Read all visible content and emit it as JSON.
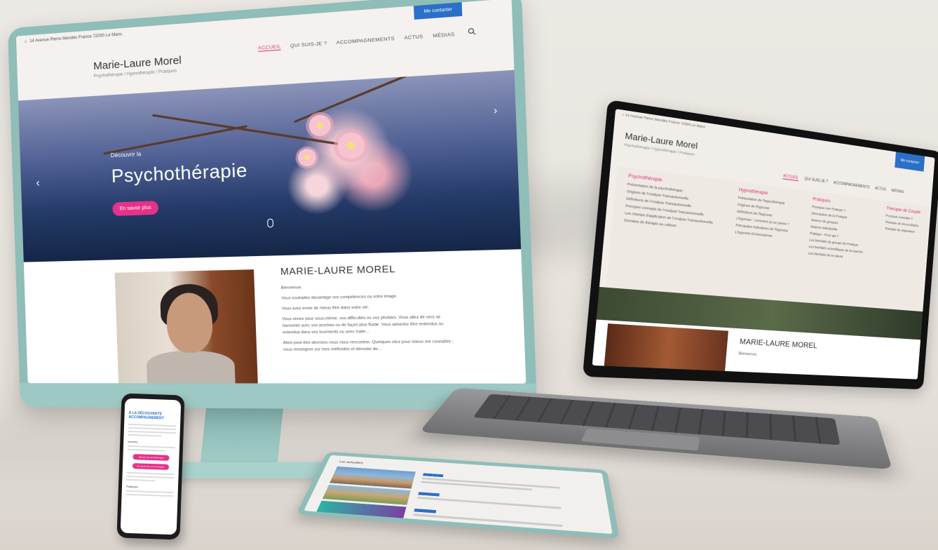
{
  "desktop": {
    "address": "14 Avenue Pierre Mendès France 72000 Le Mans",
    "contact_pill": "Me contacter",
    "logo_name": "Marie-Laure Morel",
    "logo_sub": "Psychothérapie / Hypnothérapie / Pratiques",
    "nav": [
      "ACCUEIL",
      "QUI SUIS-JE ?",
      "ACCOMPAGNEMENTS",
      "ACTUS",
      "MÉDIAS"
    ],
    "hero_kicker": "Découvrir la",
    "hero_title": "Psychothérapie",
    "hero_button": "En savoir plus",
    "about_title": "MARIE-LAURE MOREL",
    "about_greeting": "Bienvenue,",
    "about_p1": "Vous souhaitez davantage vos compétences ou votre image.",
    "about_p2": "Vous avez envie de mieux être dans votre vie.",
    "about_p3": "Vous venez pour vous-même, vos difficultés ou vos phobies. Vous allez de vers se harmonie avec vos proches ou de façon plus fluide. Vous aimeriez être entendus ou entendus dans vos tourments ou avec traite...",
    "about_p4": "Alors peut être devrions nous nous rencontrer. Quelques clics pour mieux me connaître ; vous renseigner sur mes méthodes et dérouler de..."
  },
  "laptop": {
    "address": "14 Avenue Pierre Mendès France 72000 Le Mans",
    "contact_pill": "Me contacter",
    "logo_name": "Marie-Laure Morel",
    "logo_sub": "Psychothérapie / Hypnothérapie / Pratiques",
    "nav": [
      "ACCUEIL",
      "QUI SUIS-JE ?",
      "ACCOMPAGNEMENTS",
      "ACTUS",
      "MÉDIAS"
    ],
    "menu_columns": [
      {
        "title": "Psychothérapie",
        "items": [
          "Présentation de la psychothérapie",
          "Origines de l'Analyse Transactionnelle",
          "Définitions de l'Analyse Transactionnelle",
          "Principes concepts de l'Analyse Transactionnelle",
          "Les champs d'application de l'Analyse Transactionnelle",
          "Domaine de thérapie au cabinet"
        ]
      },
      {
        "title": "Hypnothérapie",
        "items": [
          "Présentation de l'hypnothérapie",
          "Origines de l'hypnose",
          "Définitions de l'hypnose",
          "L'hypnose : comment ça se passe ?",
          "Principales indications de l'hypnose",
          "L'hypnose Ericksonienne"
        ]
      },
      {
        "title": "Pratiques",
        "items": [
          "Pourquoi une Pratique ?",
          "Description de la Pratique",
          "Séance de groupes",
          "Séance individuelle",
          "Pratique - Pour qui ?",
          "Les bienfaits du groupe de Pratique",
          "Les bienfaits scientifiques de la marche",
          "Les bienfaits de la nature"
        ]
      },
      {
        "title": "Thérapie de Couple",
        "items": [
          "Pourquoi consulter ?",
          "Thérapie de réconciliation",
          "Thérapie de séparation"
        ]
      }
    ],
    "about_title": "MARIE-LAURE MOREL",
    "about_greeting": "Bienvenue,"
  },
  "phone": {
    "title": "A LA DÉCOUVERTE ACCOMPAGNEMENT",
    "section_label": "Journée",
    "button1": "Séance de psychothérapie",
    "button2": "En savoir plus sur la thérapie",
    "link": "Pratiques"
  },
  "tablet": {
    "section": "Les actualités"
  }
}
